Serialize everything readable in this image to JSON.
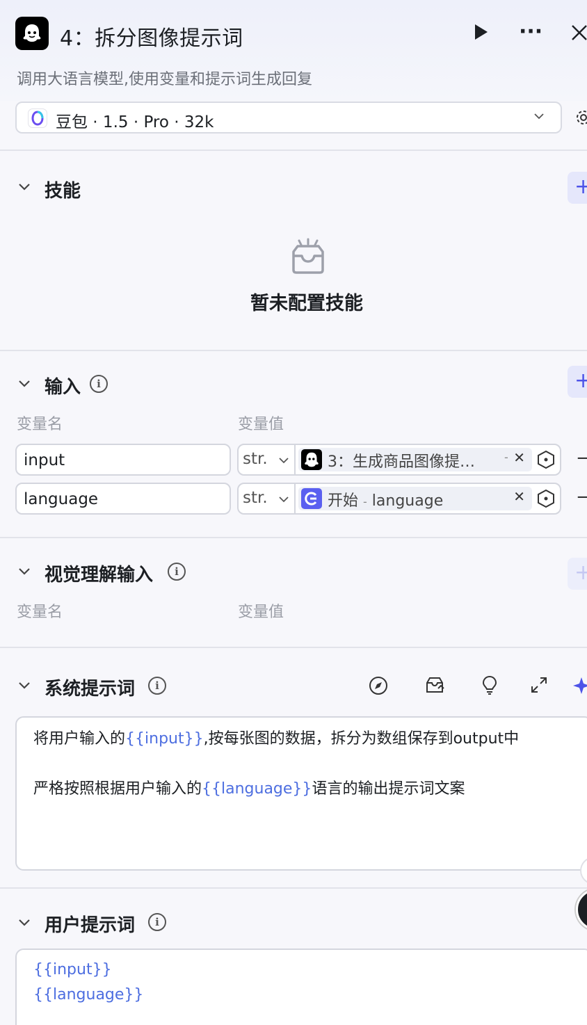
{
  "header": {
    "title": "4：拆分图像提示词",
    "subtitle": "调用大语言模型,使用变量和提示词生成回复"
  },
  "model": {
    "label": "豆包 · 1.5 · Pro · 32k"
  },
  "skills": {
    "title": "技能",
    "empty_text": "暂未配置技能"
  },
  "inputs": {
    "title": "输入",
    "col_name": "变量名",
    "col_value": "变量值",
    "rows": [
      {
        "name": "input",
        "type": "str.",
        "ref": "3：生成商品图像提…",
        "ref_suffix": "-"
      },
      {
        "name": "language",
        "type": "str.",
        "ref_prefix": "开始",
        "ref_sep": "-",
        "ref": "language"
      }
    ]
  },
  "vision": {
    "title": "视觉理解输入",
    "col_name": "变量名",
    "col_value": "变量值"
  },
  "system_prompt": {
    "title": "系统提示词",
    "line1_before": "将用户输入的",
    "line1_var": "{{input}}",
    "line1_after": ",按每张图的数据，拆分为数组保存到output中",
    "line2_before": "严格按照根据用户输入的",
    "line2_var": "{{language}}",
    "line2_after": "语言的输出提示词文案"
  },
  "user_prompt": {
    "title": "用户提示词",
    "line1": "{{input}}",
    "line2": "{{language}}"
  },
  "colors": {
    "accent": "#4d53e8",
    "variable": "#4d6ee0"
  }
}
